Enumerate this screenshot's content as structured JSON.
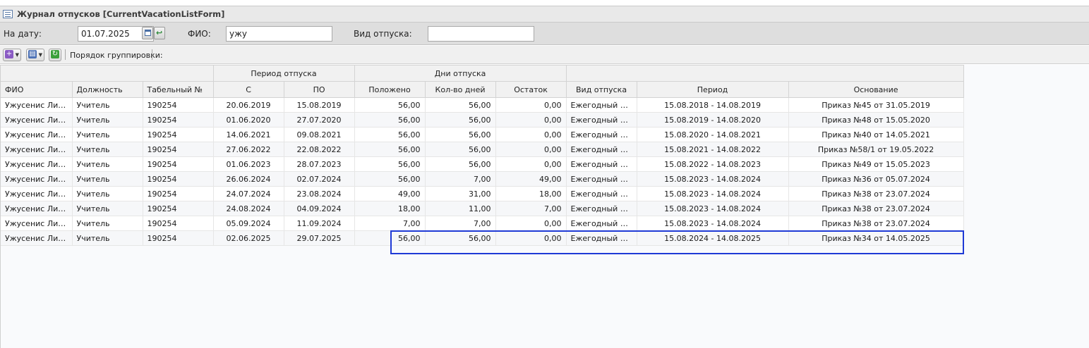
{
  "window": {
    "title": "Журнал отпусков [CurrentVacationListForm]"
  },
  "filters": {
    "date_label": "На дату:",
    "date_value": "01.07.2025",
    "fio_label": "ФИО:",
    "fio_value": "ужу",
    "type_label": "Вид отпуска:",
    "type_value": ""
  },
  "toolbar": {
    "grouping_label": "Порядок группировки:"
  },
  "grid": {
    "group_headers": {
      "period": "Период отпуска",
      "days": "Дни отпуска"
    },
    "columns": {
      "fio": "ФИО",
      "position": "Должность",
      "tabnum": "Табельный №",
      "from": "С",
      "to": "ПО",
      "entitled": "Положено",
      "count": "Кол-во дней",
      "remain": "Остаток",
      "type": "Вид отпуска",
      "period": "Период",
      "basis": "Основание"
    },
    "rows": [
      [
        "Ужусенис Лилия",
        "Учитель",
        "190254",
        "20.06.2019",
        "15.08.2019",
        "56,00",
        "56,00",
        "0,00",
        "Ежегодный отпуск",
        "15.08.2018 - 14.08.2019",
        "Приказ №45 от 31.05.2019"
      ],
      [
        "Ужусенис Лилия",
        "Учитель",
        "190254",
        "01.06.2020",
        "27.07.2020",
        "56,00",
        "56,00",
        "0,00",
        "Ежегодный отпуск",
        "15.08.2019 - 14.08.2020",
        "Приказ №48 от 15.05.2020"
      ],
      [
        "Ужусенис Лилия",
        "Учитель",
        "190254",
        "14.06.2021",
        "09.08.2021",
        "56,00",
        "56,00",
        "0,00",
        "Ежегодный отпуск",
        "15.08.2020 - 14.08.2021",
        "Приказ №40 от 14.05.2021"
      ],
      [
        "Ужусенис Лилия",
        "Учитель",
        "190254",
        "27.06.2022",
        "22.08.2022",
        "56,00",
        "56,00",
        "0,00",
        "Ежегодный отпуск",
        "15.08.2021 - 14.08.2022",
        "Приказ №58/1 от 19.05.2022"
      ],
      [
        "Ужусенис Лилия",
        "Учитель",
        "190254",
        "01.06.2023",
        "28.07.2023",
        "56,00",
        "56,00",
        "0,00",
        "Ежегодный отпуск",
        "15.08.2022 - 14.08.2023",
        "Приказ №49 от 15.05.2023"
      ],
      [
        "Ужусенис Лилия",
        "Учитель",
        "190254",
        "26.06.2024",
        "02.07.2024",
        "56,00",
        "7,00",
        "49,00",
        "Ежегодный отпуск",
        "15.08.2023 - 14.08.2024",
        "Приказ №36 от 05.07.2024"
      ],
      [
        "Ужусенис Лилия",
        "Учитель",
        "190254",
        "24.07.2024",
        "23.08.2024",
        "49,00",
        "31,00",
        "18,00",
        "Ежегодный отпуск",
        "15.08.2023 - 14.08.2024",
        "Приказ №38 от 23.07.2024"
      ],
      [
        "Ужусенис Лилия",
        "Учитель",
        "190254",
        "24.08.2024",
        "04.09.2024",
        "18,00",
        "11,00",
        "7,00",
        "Ежегодный отпуск",
        "15.08.2023 - 14.08.2024",
        "Приказ №38 от 23.07.2024"
      ],
      [
        "Ужусенис Лилия",
        "Учитель",
        "190254",
        "05.09.2024",
        "11.09.2024",
        "7,00",
        "7,00",
        "0,00",
        "Ежегодный отпуск",
        "15.08.2023 - 14.08.2024",
        "Приказ №38 от 23.07.2024"
      ],
      [
        "Ужусенис Лилия",
        "Учитель",
        "190254",
        "02.06.2025",
        "29.07.2025",
        "56,00",
        "56,00",
        "0,00",
        "Ежегодный отпуск",
        "15.08.2024 - 14.08.2025",
        "Приказ №34 от 14.05.2025"
      ]
    ]
  },
  "colors": {
    "highlight": "#1f3ad6",
    "add_button": "#8a5bc4",
    "refresh_button": "#3aa03a",
    "print_button": "#4a6fb5"
  }
}
